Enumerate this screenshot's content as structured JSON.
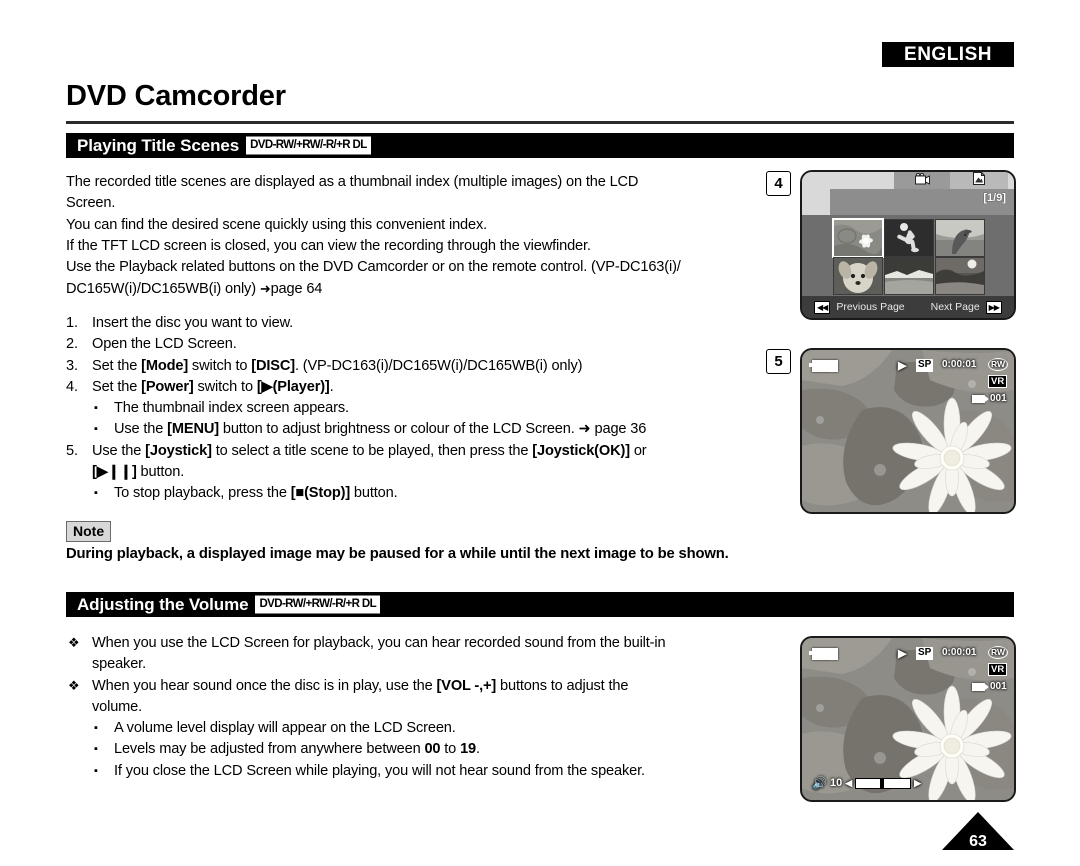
{
  "header": {
    "language_badge": "ENGLISH",
    "doc_title": "DVD Camcorder"
  },
  "sections": [
    {
      "id": "playing-title-scenes",
      "title": "Playing Title Scenes",
      "disc_badge": "DVD-RW/+RW/-R/+R DL"
    },
    {
      "id": "adjusting-the-volume",
      "title": "Adjusting the Volume",
      "disc_badge": "DVD-RW/+RW/-R/+R DL"
    }
  ],
  "intro_paragraph": {
    "line1": "The recorded title scenes are displayed as a thumbnail index (multiple images) on the LCD",
    "line2": "Screen.",
    "line3": "You can find the desired scene quickly using this convenient index.",
    "line4": "If the TFT LCD screen is closed, you can view the recording through the viewfinder.",
    "line5": "Use the Playback related buttons on the DVD Camcorder or on the remote control. (VP-DC163(i)/",
    "line6_pre": "DC165W(i)/DC165WB(i) only) ",
    "line6_arrow": "➜",
    "line6_ref": "page 64"
  },
  "steps": [
    {
      "num": "1.",
      "parts": [
        {
          "t": "Insert the disc you want to view.",
          "bold": false
        }
      ]
    },
    {
      "num": "2.",
      "parts": [
        {
          "t": "Open the LCD Screen.",
          "bold": false
        }
      ]
    },
    {
      "num": "3.",
      "parts": [
        {
          "t": "Set the ",
          "bold": false
        },
        {
          "t": "[Mode]",
          "bold": true
        },
        {
          "t": " switch to ",
          "bold": false
        },
        {
          "t": "[DISC]",
          "bold": true
        },
        {
          "t": ". (VP-DC163(i)/DC165W(i)/DC165WB(i) only)",
          "bold": false
        }
      ]
    },
    {
      "num": "4.",
      "parts": [
        {
          "t": "Set the ",
          "bold": false
        },
        {
          "t": "[Power]",
          "bold": true
        },
        {
          "t": " switch to ",
          "bold": false
        },
        {
          "t": "[▶(Player)]",
          "bold": true
        },
        {
          "t": ".",
          "bold": false
        }
      ],
      "subs": [
        {
          "parts": [
            {
              "t": "The thumbnail index screen appears.",
              "bold": false
            }
          ]
        },
        {
          "parts": [
            {
              "t": "Use the ",
              "bold": false
            },
            {
              "t": "[MENU]",
              "bold": true
            },
            {
              "t": " button to adjust brightness or colour of the LCD Screen. ➜ page 36",
              "bold": false
            }
          ]
        }
      ]
    },
    {
      "num": "5.",
      "parts": [
        {
          "t": "Use the ",
          "bold": false
        },
        {
          "t": "[Joystick]",
          "bold": true
        },
        {
          "t": " to select a title scene to be played, then press the ",
          "bold": false
        },
        {
          "t": "[Joystick(OK)]",
          "bold": true
        },
        {
          "t": " or",
          "bold": false
        }
      ],
      "cont": [
        {
          "t": "[▶❙❙]",
          "bold": true
        },
        {
          "t": " button.",
          "bold": false
        }
      ],
      "subs": [
        {
          "parts": [
            {
              "t": "To stop playback, press the ",
              "bold": false
            },
            {
              "t": "[■(Stop)]",
              "bold": true
            },
            {
              "t": " button.",
              "bold": false
            }
          ]
        }
      ]
    }
  ],
  "note": {
    "label": "Note",
    "text": "During playback, a displayed image may be paused for a while until the next image to be shown."
  },
  "volume_bullets": [
    {
      "parts": [
        {
          "t": "When you use the LCD Screen for playback, you can hear recorded sound from the built-in",
          "bold": false
        }
      ],
      "cont": [
        {
          "t": "speaker.",
          "bold": false
        }
      ]
    },
    {
      "parts": [
        {
          "t": "When you hear sound once the disc is in play, use the ",
          "bold": false
        },
        {
          "t": "[VOL -,+]",
          "bold": true
        },
        {
          "t": " buttons to adjust the",
          "bold": false
        }
      ],
      "cont": [
        {
          "t": "volume.",
          "bold": false
        }
      ],
      "subs": [
        {
          "parts": [
            {
              "t": "A volume level display will appear on the LCD Screen.",
              "bold": false
            }
          ]
        },
        {
          "parts": [
            {
              "t": "Levels may be adjusted from anywhere between ",
              "bold": false
            },
            {
              "t": "00",
              "bold": true
            },
            {
              "t": " to ",
              "bold": false
            },
            {
              "t": "19",
              "bold": true
            },
            {
              "t": ".",
              "bold": false
            }
          ]
        },
        {
          "parts": [
            {
              "t": "If you close the LCD Screen while playing, you will not hear sound from the speaker.",
              "bold": false
            }
          ]
        }
      ]
    }
  ],
  "figures": {
    "step4_label": "4",
    "step5_label": "5",
    "thumbnail_screen": {
      "tabs": [
        {
          "name": "movie-tab",
          "icon": "movie-icon",
          "active": true
        },
        {
          "name": "photo-tab",
          "icon": "photo-icon",
          "active": false
        }
      ],
      "page_indicator": "[1/9]",
      "thumbnails": [
        {
          "caption": "water-lily",
          "selected": true
        },
        {
          "caption": "soccer-player",
          "selected": false
        },
        {
          "caption": "dolphin",
          "selected": false
        },
        {
          "caption": "dog",
          "selected": false
        },
        {
          "caption": "lake",
          "selected": false
        },
        {
          "caption": "field",
          "selected": false
        }
      ],
      "prev_page_label": "Previous Page",
      "next_page_label": "Next Page",
      "prev_icon": "◀◀",
      "next_icon": "▶▶"
    },
    "playback_screen": {
      "play_icon": "▶",
      "record_mode": "SP",
      "timecode": "0:00:01",
      "disc_type": "RW",
      "format": "VR",
      "scene_number": "001"
    },
    "volume_screen": {
      "play_icon": "▶",
      "record_mode": "SP",
      "timecode": "0:00:01",
      "disc_type": "RW",
      "format": "VR",
      "scene_number": "001",
      "volume_level": "10"
    }
  },
  "page_number": "63",
  "colors": {
    "bar_background": "#000000",
    "bar_text": "#ffffff",
    "note_tag_bg": "#d8d8d8"
  }
}
